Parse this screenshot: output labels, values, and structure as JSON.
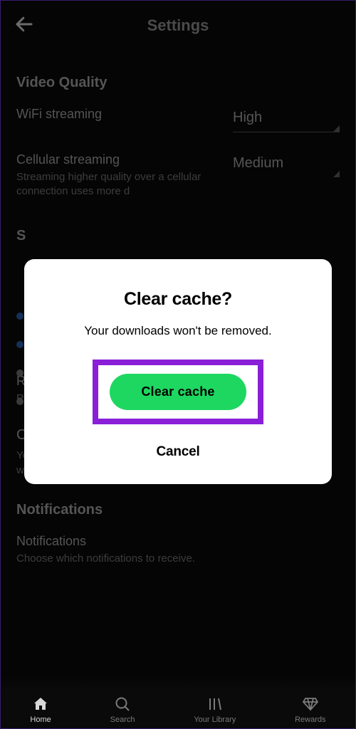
{
  "header": {
    "title": "Settings"
  },
  "sections": {
    "video_quality": {
      "heading": "Video Quality",
      "rows": [
        {
          "label": "WiFi streaming",
          "value": "High"
        },
        {
          "label": "Cellular streaming",
          "desc": "Streaming higher quality over a cellular connection uses more d",
          "value": "Medium"
        }
      ]
    },
    "hidden_heading_s": "S",
    "hidden_heading_r": "R",
    "hidden_desc_r": "R",
    "clear_cache": {
      "heading": "Clear cache",
      "desc": "You can free up storage by clearing your cache. Your downloads won't be removed."
    },
    "notifications": {
      "heading": "Notifications",
      "row_label": "Notifications",
      "row_desc": "Choose which notifications to receive."
    }
  },
  "nav": {
    "items": [
      {
        "label": "Home"
      },
      {
        "label": "Search"
      },
      {
        "label": "Your Library"
      },
      {
        "label": "Rewards"
      }
    ]
  },
  "modal": {
    "title": "Clear cache?",
    "body": "Your downloads won't be removed.",
    "primary": "Clear cache",
    "cancel": "Cancel"
  },
  "colors": {
    "accent_green": "#1ed760",
    "highlight_purple": "#8a1fd8"
  }
}
